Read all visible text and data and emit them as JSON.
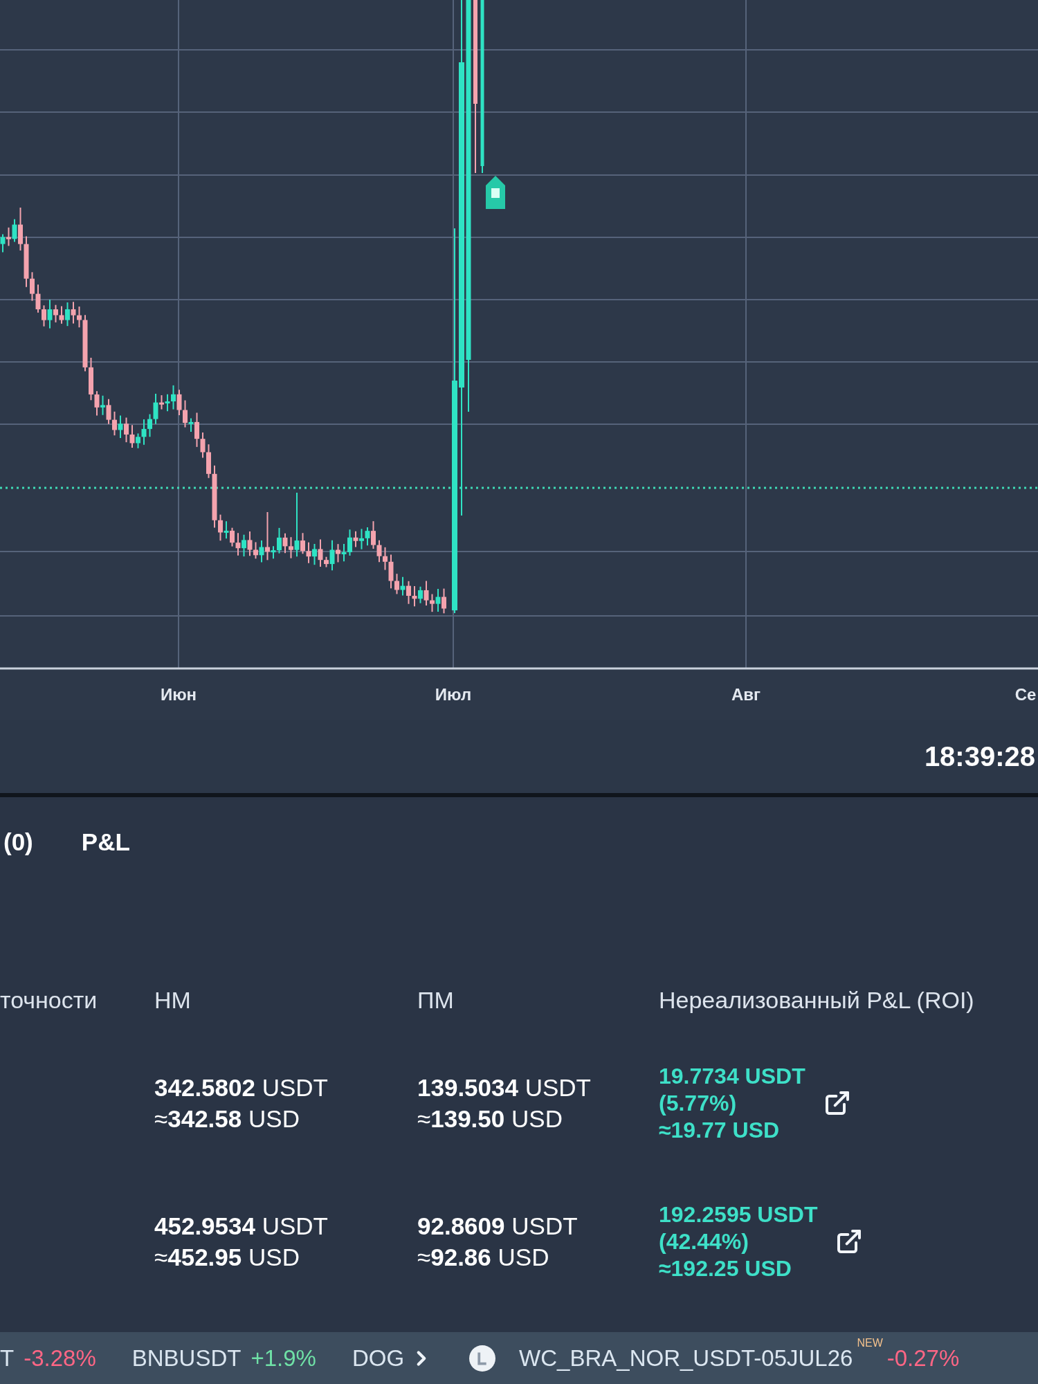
{
  "chart": {
    "x_labels": [
      "Июн",
      "Июл",
      "Авг",
      "Се"
    ],
    "time": "18:39:28"
  },
  "panel": {
    "tabs": [
      {
        "label": "(0)"
      },
      {
        "label": "P&L"
      }
    ],
    "table": {
      "columns": [
        "точности",
        "НМ",
        "ПМ",
        "Нереализованный P&L (ROI)"
      ],
      "rows": [
        {
          "nm": {
            "amount": "**342.5802** USDT",
            "usd": "≈**342.58** USD"
          },
          "pm": {
            "amount": "**139.5034** USDT",
            "usd": "≈**139.50** USD"
          },
          "pnl": {
            "positive": true,
            "amount": "19.7734 USDT",
            "roi": "(5.77%)",
            "usd": "≈19.77 USD"
          }
        },
        {
          "nm": {
            "amount": "**452.9534** USDT",
            "usd": "≈**452.95** USD"
          },
          "pm": {
            "amount": "**92.8609** USDT",
            "usd": "≈**92.86** USD"
          },
          "pnl": {
            "positive": true,
            "amount": "192.2595 USDT",
            "roi": "(42.44%)",
            "usd": "≈192.25 USD"
          }
        }
      ]
    }
  },
  "ticker": {
    "items": [
      {
        "symbol": "T",
        "change": "-3.28%",
        "positive": false
      },
      {
        "symbol": "BNBUSDT",
        "change": "+1.9%",
        "positive": true
      },
      {
        "symbol": "DOG"
      }
    ],
    "pinned": {
      "symbol": "WC_BRA_NOR_USDT-05JUL26",
      "badge": "NEW",
      "change": "-0.27%",
      "positive": false
    }
  }
}
